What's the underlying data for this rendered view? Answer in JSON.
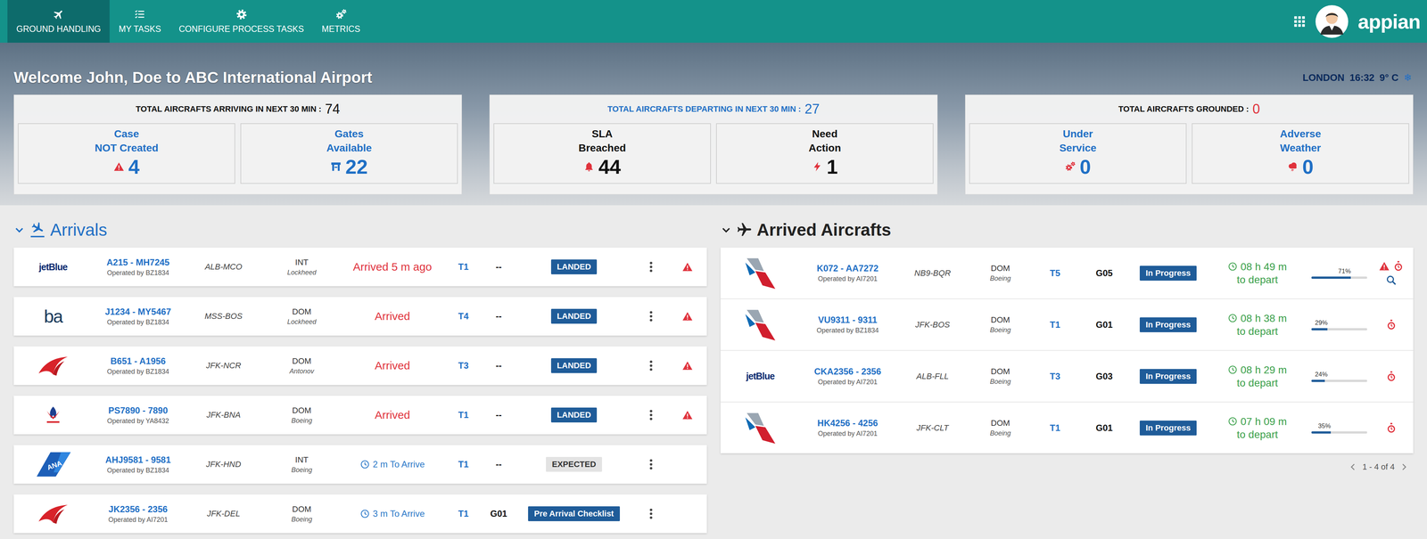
{
  "nav": {
    "tabs": [
      {
        "label": "GROUND HANDLING",
        "kind": "plane",
        "selected": true
      },
      {
        "label": "MY TASKS",
        "kind": "tasks",
        "selected": false
      },
      {
        "label": "CONFIGURE PROCESS TASKS",
        "kind": "settings",
        "selected": false
      },
      {
        "label": "METRICS",
        "kind": "metrics",
        "selected": false
      }
    ],
    "brand": "appian"
  },
  "banner": {
    "welcome": "Welcome John, Doe to ABC International Airport",
    "weather": {
      "city": "LONDON",
      "time": "16:32",
      "temp": "9° C",
      "icon": "❄"
    }
  },
  "summary": [
    {
      "title": "TOTAL AIRCRAFTS ARRIVING IN NEXT 30 MIN :",
      "count": "74",
      "title_color": "#111111",
      "count_color": "#111111",
      "stats": [
        {
          "kind": "warning",
          "lines": [
            "Case",
            "NOT Created"
          ],
          "value": "4",
          "color": "#1f6fc5",
          "icon_color": "#e0323c"
        },
        {
          "kind": "gate",
          "lines": [
            "Gates",
            "Available"
          ],
          "value": "22",
          "color": "#1f6fc5",
          "icon_color": "#1f6fc5"
        }
      ]
    },
    {
      "title": "TOTAL AIRCRAFTS DEPARTING IN NEXT 30 MIN :",
      "count": "27",
      "title_color": "#1f6fc5",
      "count_color": "#1f6fc5",
      "stats": [
        {
          "kind": "bell",
          "lines": [
            "SLA",
            "Breached"
          ],
          "value": "44",
          "color": "#111111",
          "icon_color": "#e0323c"
        },
        {
          "kind": "bolt",
          "lines": [
            "Need",
            "Action"
          ],
          "value": "1",
          "color": "#111111",
          "icon_color": "#e0323c"
        }
      ]
    },
    {
      "title": "TOTAL AIRCRAFTS GROUNDED :",
      "count": "0",
      "title_color": "#111111",
      "count_color": "#e0323c",
      "stats": [
        {
          "kind": "gears",
          "lines": [
            "Under",
            "Service"
          ],
          "value": "0",
          "color": "#1f6fc5",
          "icon_color": "#e0323c"
        },
        {
          "kind": "weather",
          "lines": [
            "Adverse",
            "Weather"
          ],
          "value": "0",
          "color": "#1f6fc5",
          "icon_color": "#e0323c"
        }
      ]
    }
  ],
  "arrivals": {
    "title": "Arrivals",
    "expanded": true,
    "rows": [
      {
        "logo": {
          "kind": "jetblue",
          "text": "jetBlue"
        },
        "flight": "A215 - MH7245",
        "operator": "Operated by BZ1834",
        "route": "ALB-MCO",
        "scope": "INT",
        "aircraft": "Lockheed",
        "status": {
          "kind": "arrived",
          "text": "Arrived 5 m ago"
        },
        "terminal": "T1",
        "gate": "--",
        "badge": {
          "text": "LANDED",
          "color": "#1f5c99",
          "text_color": "#ffffff"
        },
        "warning": true
      },
      {
        "logo": {
          "kind": "ba",
          "text": "ba"
        },
        "flight": "J1234 - MY5467",
        "operator": "Operated by BZ1834",
        "route": "MSS-BOS",
        "scope": "DOM",
        "aircraft": "Lockheed",
        "status": {
          "kind": "arrived",
          "text": "Arrived"
        },
        "terminal": "T4",
        "gate": "--",
        "badge": {
          "text": "LANDED",
          "color": "#1f5c99",
          "text_color": "#ffffff"
        },
        "warning": true
      },
      {
        "logo": {
          "kind": "airindia"
        },
        "flight": "B651 - A1956",
        "operator": "Operated by BZ1834",
        "route": "JFK-NCR",
        "scope": "DOM",
        "aircraft": "Antonov",
        "status": {
          "kind": "arrived",
          "text": "Arrived"
        },
        "terminal": "T3",
        "gate": "--",
        "badge": {
          "text": "LANDED",
          "color": "#1f5c99",
          "text_color": "#ffffff"
        },
        "warning": true
      },
      {
        "logo": {
          "kind": "alliance"
        },
        "flight": "PS7890 - 7890",
        "operator": "Operated by YA8432",
        "route": "JFK-BNA",
        "scope": "DOM",
        "aircraft": "Boeing",
        "status": {
          "kind": "arrived",
          "text": "Arrived"
        },
        "terminal": "T1",
        "gate": "--",
        "badge": {
          "text": "LANDED",
          "color": "#1f5c99",
          "text_color": "#ffffff"
        },
        "warning": true
      },
      {
        "logo": {
          "kind": "ana",
          "text": "ANA"
        },
        "flight": "AHJ9581 - 9581",
        "operator": "Operated by BZ1834",
        "route": "JFK-HND",
        "scope": "INT",
        "aircraft": "Boeing",
        "status": {
          "kind": "expected",
          "text": "2 m To Arrive"
        },
        "terminal": "T1",
        "gate": "--",
        "badge": {
          "text": "EXPECTED",
          "color": "#e3e3e3",
          "text_color": "#333333"
        },
        "warning": false
      },
      {
        "logo": {
          "kind": "airindia"
        },
        "flight": "JK2356 - 2356",
        "operator": "Operated by AI7201",
        "route": "JFK-DEL",
        "scope": "DOM",
        "aircraft": "Boeing",
        "status": {
          "kind": "expected",
          "text": "3 m To Arrive"
        },
        "terminal": "T1",
        "gate": "G01",
        "badge": {
          "text": "Pre Arrival Checklist",
          "color": "#1f5c99",
          "text_color": "#ffffff"
        },
        "warning": false
      }
    ]
  },
  "arrived": {
    "title": "Arrived Aircrafts",
    "expanded": true,
    "pagination": "1 - 4 of 4",
    "rows": [
      {
        "logo": {
          "kind": "aa"
        },
        "flight": "K072 - AA7272",
        "operator": "Operated by AI7201",
        "route": "NB9-BQR",
        "scope": "DOM",
        "aircraft": "Boeing",
        "terminal": "T5",
        "gate": "G05",
        "badge": {
          "text": "In Progress",
          "color": "#1f5c99",
          "text_color": "#ffffff"
        },
        "depart": [
          "08 h 49 m",
          "to depart"
        ],
        "progress": {
          "level": 0.71,
          "reading": "71%"
        },
        "warning": true,
        "search": true
      },
      {
        "logo": {
          "kind": "aa"
        },
        "flight": "VU9311 - 9311",
        "operator": "Operated by BZ1834",
        "route": "JFK-BOS",
        "scope": "DOM",
        "aircraft": "Boeing",
        "terminal": "T1",
        "gate": "G01",
        "badge": {
          "text": "In Progress",
          "color": "#1f5c99",
          "text_color": "#ffffff"
        },
        "depart": [
          "08 h 38 m",
          "to depart"
        ],
        "progress": {
          "level": 0.29,
          "reading": "29%"
        },
        "warning": false,
        "search": false
      },
      {
        "logo": {
          "kind": "jetblue",
          "text": "jetBlue"
        },
        "flight": "CKA2356 - 2356",
        "operator": "Operated by AI7201",
        "route": "ALB-FLL",
        "scope": "DOM",
        "aircraft": "Boeing",
        "terminal": "T3",
        "gate": "G03",
        "badge": {
          "text": "In Progress",
          "color": "#1f5c99",
          "text_color": "#ffffff"
        },
        "depart": [
          "08 h 29 m",
          "to depart"
        ],
        "progress": {
          "level": 0.24,
          "reading": "24%"
        },
        "warning": false,
        "search": false
      },
      {
        "logo": {
          "kind": "aa"
        },
        "flight": "HK4256 - 4256",
        "operator": "Operated by AI7201",
        "route": "JFK-CLT",
        "scope": "DOM",
        "aircraft": "Boeing",
        "terminal": "T1",
        "gate": "G01",
        "badge": {
          "text": "In Progress",
          "color": "#1f5c99",
          "text_color": "#ffffff"
        },
        "depart": [
          "07 h 09 m",
          "to depart"
        ],
        "progress": {
          "level": 0.35,
          "reading": "35%"
        },
        "warning": false,
        "search": false
      }
    ]
  }
}
